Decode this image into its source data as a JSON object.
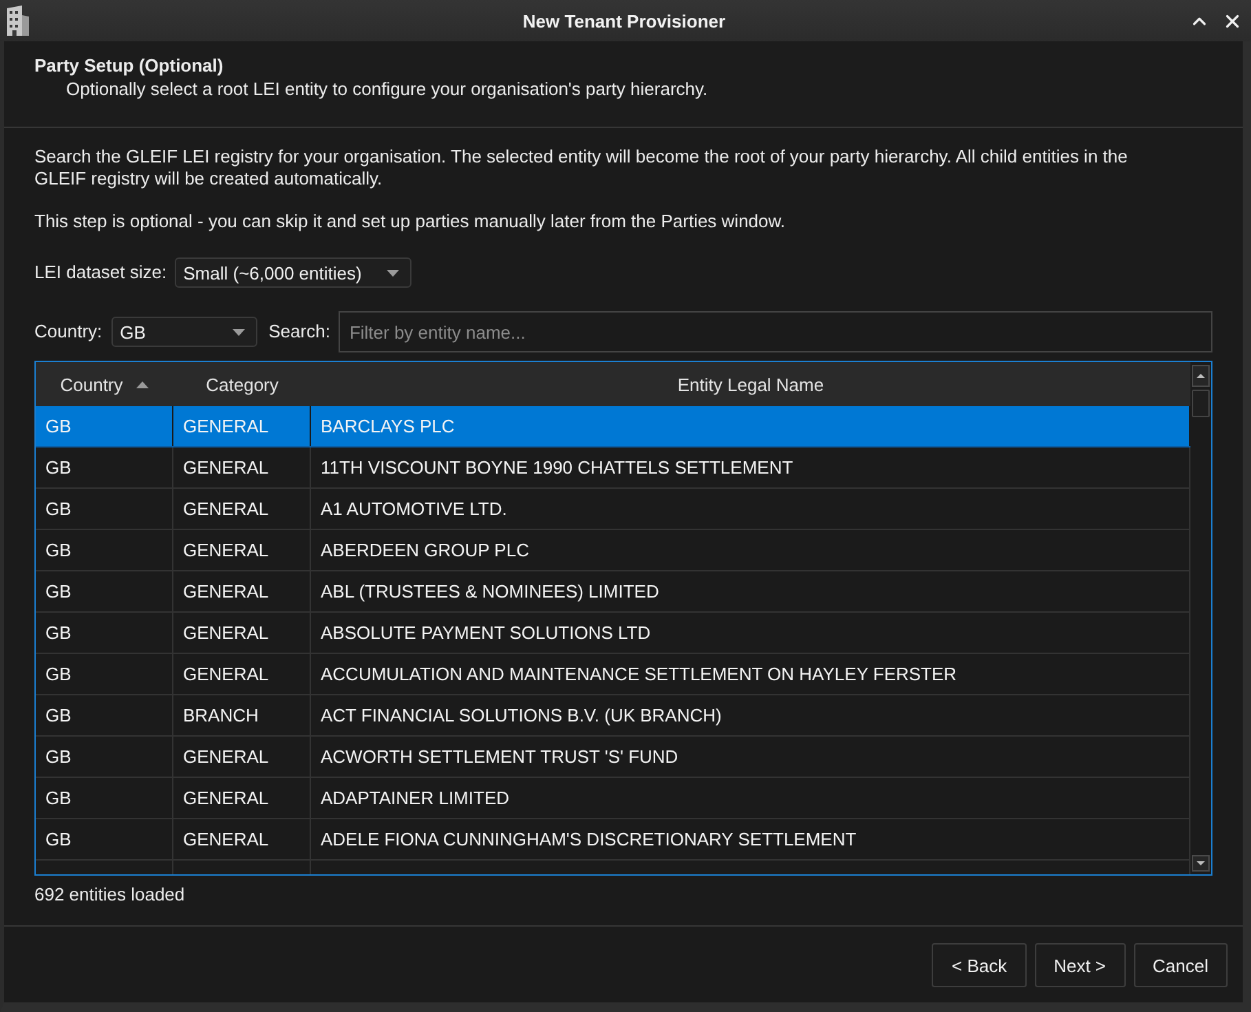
{
  "window": {
    "title": "New Tenant Provisioner"
  },
  "header": {
    "title": "Party Setup (Optional)",
    "subtitle": "Optionally select a root LEI entity to configure your organisation's party hierarchy."
  },
  "intro": [
    "Search the GLEIF LEI registry for your organisation. The selected entity will become the root of your party hierarchy. All child entities in the GLEIF registry will be created automatically.",
    "This step is optional - you can skip it and set up parties manually later from the Parties window."
  ],
  "dataset_size": {
    "label": "LEI dataset size:",
    "value": "Small (~6,000 entities)"
  },
  "filters": {
    "country_label": "Country:",
    "country_value": "GB",
    "search_label": "Search:",
    "search_placeholder": "Filter by entity name..."
  },
  "table": {
    "columns": [
      {
        "label": "Country",
        "sorted": true
      },
      {
        "label": "Category",
        "sorted": false
      },
      {
        "label": "Entity Legal Name",
        "sorted": false
      }
    ],
    "rows": [
      {
        "country": "GB",
        "category": "GENERAL",
        "name": "BARCLAYS PLC",
        "selected": true
      },
      {
        "country": "GB",
        "category": "GENERAL",
        "name": "11TH VISCOUNT BOYNE 1990 CHATTELS SETTLEMENT",
        "selected": false
      },
      {
        "country": "GB",
        "category": "GENERAL",
        "name": "A1 AUTOMOTIVE LTD.",
        "selected": false
      },
      {
        "country": "GB",
        "category": "GENERAL",
        "name": "ABERDEEN GROUP PLC",
        "selected": false
      },
      {
        "country": "GB",
        "category": "GENERAL",
        "name": "ABL (TRUSTEES & NOMINEES) LIMITED",
        "selected": false
      },
      {
        "country": "GB",
        "category": "GENERAL",
        "name": "ABSOLUTE PAYMENT SOLUTIONS LTD",
        "selected": false
      },
      {
        "country": "GB",
        "category": "GENERAL",
        "name": "ACCUMULATION AND MAINTENANCE SETTLEMENT ON HAYLEY FERSTER",
        "selected": false
      },
      {
        "country": "GB",
        "category": "BRANCH",
        "name": "ACT FINANCIAL SOLUTIONS B.V. (UK BRANCH)",
        "selected": false
      },
      {
        "country": "GB",
        "category": "GENERAL",
        "name": "ACWORTH SETTLEMENT TRUST 'S' FUND",
        "selected": false
      },
      {
        "country": "GB",
        "category": "GENERAL",
        "name": "ADAPTAINER LIMITED",
        "selected": false
      },
      {
        "country": "GB",
        "category": "GENERAL",
        "name": "ADELE FIONA CUNNINGHAM'S DISCRETIONARY SETTLEMENT",
        "selected": false
      }
    ]
  },
  "status": "692 entities loaded",
  "buttons": [
    {
      "label": "< Back"
    },
    {
      "label": "Next >"
    },
    {
      "label": "Cancel"
    }
  ]
}
